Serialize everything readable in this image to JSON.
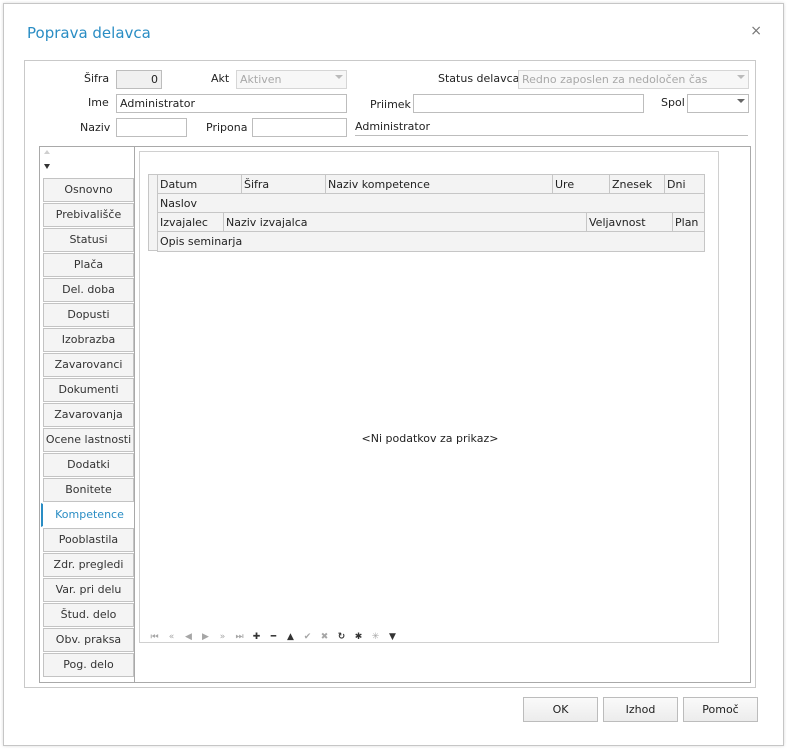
{
  "dialog": {
    "title": "Poprava delavca",
    "close": "×"
  },
  "form": {
    "sifra_label": "Šifra",
    "sifra_value": "0",
    "akt_label": "Akt",
    "akt_value": "Aktiven",
    "status_label": "Status delavca",
    "status_value": "Redno zaposlen za nedoločen čas",
    "ime_label": "Ime",
    "ime_value": "Administrator",
    "priimek_label": "Priimek",
    "priimek_value": "",
    "spol_label": "Spol",
    "spol_value": "",
    "naziv_label": "Naziv",
    "naziv_value": "",
    "pripona_label": "Pripona",
    "pripona_value": "",
    "display_name": "Administrator"
  },
  "tabs": [
    {
      "label": "Osnovno"
    },
    {
      "label": "Prebivališče"
    },
    {
      "label": "Statusi"
    },
    {
      "label": "Plača"
    },
    {
      "label": "Del. doba"
    },
    {
      "label": "Dopusti"
    },
    {
      "label": "Izobrazba"
    },
    {
      "label": "Zavarovanci"
    },
    {
      "label": "Dokumenti"
    },
    {
      "label": "Zavarovanja"
    },
    {
      "label": "Ocene lastnosti"
    },
    {
      "label": "Dodatki"
    },
    {
      "label": "Bonitete"
    },
    {
      "label": "Kompetence"
    },
    {
      "label": "Pooblastila"
    },
    {
      "label": "Zdr. pregledi"
    },
    {
      "label": "Var. pri delu"
    },
    {
      "label": "Štud. delo"
    },
    {
      "label": "Obv. praksa"
    },
    {
      "label": "Pog. delo"
    }
  ],
  "active_tab": "Kompetence",
  "grid": {
    "row1": [
      "Datum",
      "Šifra",
      "Naziv kompetence",
      "Ure",
      "Znesek",
      "Dni"
    ],
    "row2": [
      "Naslov"
    ],
    "row3": [
      "Izvajalec",
      "Naziv izvajalca",
      "Veljavnost",
      "Plan"
    ],
    "row4": [
      "Opis seminarja"
    ],
    "empty_text": "<Ni podatkov za prikaz>"
  },
  "navigator": [
    {
      "name": "first-icon",
      "glyph": "⏮"
    },
    {
      "name": "prev-page-icon",
      "glyph": "«"
    },
    {
      "name": "prev-icon",
      "glyph": "◀"
    },
    {
      "name": "next-icon",
      "glyph": "▶"
    },
    {
      "name": "next-page-icon",
      "glyph": "»"
    },
    {
      "name": "last-icon",
      "glyph": "⏭"
    },
    {
      "name": "add-icon",
      "glyph": "✚"
    },
    {
      "name": "delete-icon",
      "glyph": "━"
    },
    {
      "name": "edit-icon",
      "glyph": "▲"
    },
    {
      "name": "post-icon",
      "glyph": "✔"
    },
    {
      "name": "cancel-icon",
      "glyph": "✖"
    },
    {
      "name": "refresh-icon",
      "glyph": "↻"
    },
    {
      "name": "bookmark-icon",
      "glyph": "✱"
    },
    {
      "name": "goto-bookmark-icon",
      "glyph": "✳"
    },
    {
      "name": "filter-icon",
      "glyph": "▼"
    }
  ],
  "buttons": {
    "ok": "OK",
    "exit": "Izhod",
    "help": "Pomoč"
  },
  "colors": {
    "accent": "#2a8dc4"
  }
}
